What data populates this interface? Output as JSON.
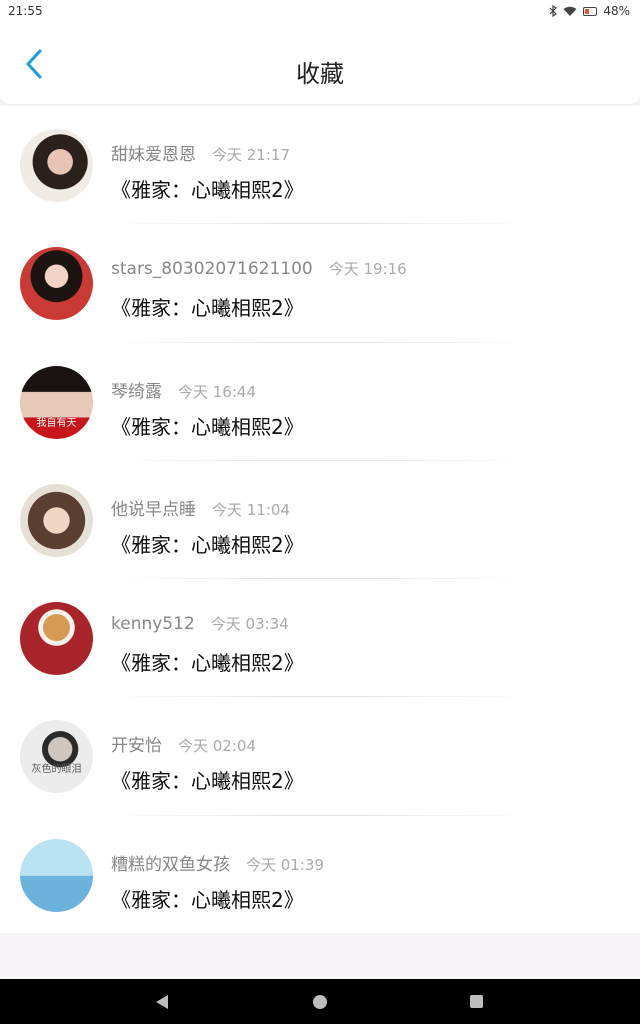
{
  "status_bar": {
    "time": "21:55",
    "battery_percent": "48%",
    "icons": [
      "bluetooth-icon",
      "wifi-icon",
      "battery-icon"
    ]
  },
  "header": {
    "title": "收藏",
    "back_icon": "chevron-left-icon",
    "accent_color": "#1a9ddb"
  },
  "favorites": [
    {
      "user": "甜妹爱恩恩",
      "time": "今天 21:17",
      "title": "《雅家：心曦相熙2》"
    },
    {
      "user": "stars_80302071621100",
      "time": "今天 19:16",
      "title": "《雅家：心曦相熙2》"
    },
    {
      "user": "琴绮露",
      "time": "今天 16:44",
      "title": "《雅家：心曦相熙2》",
      "avatar_text": "我自有天"
    },
    {
      "user": "他说早点睡",
      "time": "今天 11:04",
      "title": "《雅家：心曦相熙2》"
    },
    {
      "user": "kenny512",
      "time": "今天 03:34",
      "title": "《雅家：心曦相熙2》"
    },
    {
      "user": "开安怡",
      "time": "今天 02:04",
      "title": "《雅家：心曦相熙2》",
      "avatar_text": "灰色的眼泪"
    },
    {
      "user": "糟糕的双鱼女孩",
      "time": "今天 01:39",
      "title": "《雅家：心曦相熙2》"
    }
  ],
  "nav_bar": {
    "buttons": [
      "back-triangle-icon",
      "home-circle-icon",
      "recents-square-icon"
    ]
  }
}
